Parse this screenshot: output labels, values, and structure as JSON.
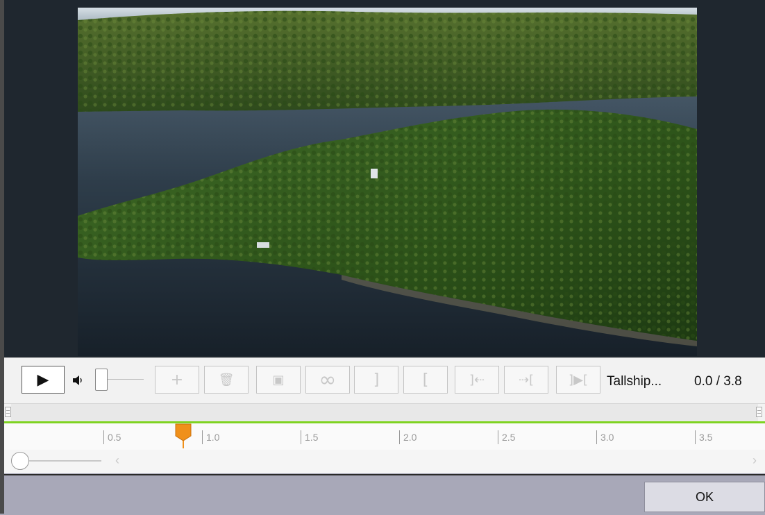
{
  "toolbar": {
    "clip_name": "Tallship...",
    "time_readout": "0.0 / 3.8",
    "buttons": {
      "play": "▶",
      "add": "+",
      "delete": "🗑",
      "snapshot": "▣",
      "loop": "∞",
      "mark_out": "]",
      "mark_in": "[",
      "go_to_out": "]⇠",
      "go_to_in": "⇢[",
      "play_selection": "]▶["
    },
    "volume_level": 0
  },
  "timeline": {
    "ticks": [
      "0.5",
      "1.0",
      "1.5",
      "2.0",
      "2.5",
      "3.0",
      "3.5"
    ],
    "playhead_value": 0.8,
    "accent_color": "#f0901a",
    "range_color": "#7ed321"
  },
  "zoom": {
    "scroll_left": "‹",
    "scroll_right": "›"
  },
  "footer": {
    "ok_label": "OK"
  },
  "icons": [
    "play-icon",
    "speaker-icon",
    "plus-icon",
    "trash-icon",
    "snapshot-icon",
    "loop-icon"
  ]
}
